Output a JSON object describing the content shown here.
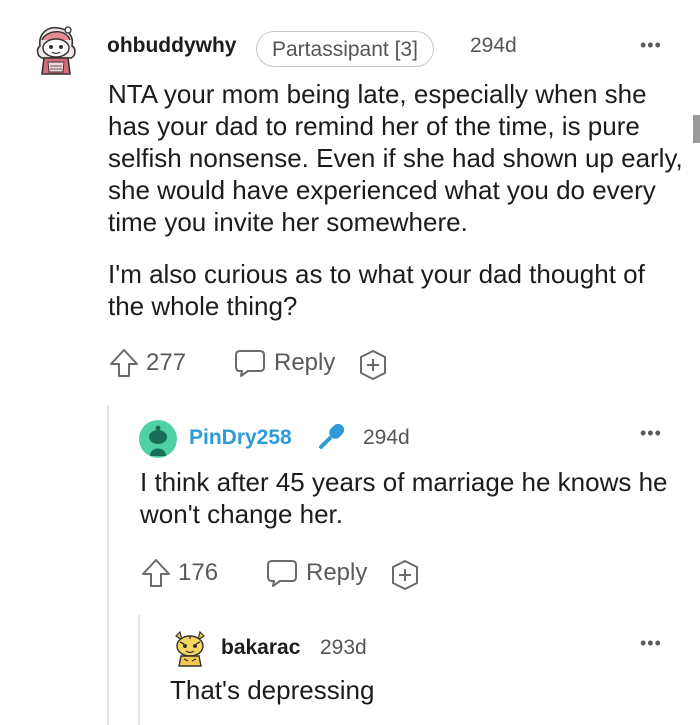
{
  "comment": {
    "username": "ohbuddywhy",
    "flair": "Partassipant [3]",
    "age": "294d",
    "more_icon": "•••",
    "paragraphs": [
      "NTA your mom being late, especially when she has your dad to remind her of the time, is pure selfish nonsense. Even if she had shown up early, she would have experienced what you do every time you invite her somewhere.",
      "I'm also curious as to what your dad thought of the whole thing?"
    ],
    "upvotes": "277",
    "reply_label": "Reply",
    "icons": {
      "avatar": "snoo-avatar-icon",
      "upvote": "upvote-arrow-icon",
      "reply": "speech-bubble-icon",
      "award": "award-plus-icon"
    }
  },
  "reply1": {
    "username": "PinDry258",
    "age": "294d",
    "more_icon": "•••",
    "text": "I think after 45 years of marriage he knows he won't change her.",
    "upvotes": "176",
    "reply_label": "Reply",
    "icons": {
      "avatar": "green-snoo-avatar-icon",
      "badge": "microphone-icon"
    },
    "username_color": "#2e9ad6"
  },
  "reply2": {
    "username": "bakarac",
    "age": "293d",
    "more_icon": "•••",
    "text": "That's depressing",
    "icons": {
      "avatar": "yellow-snoo-avatar-icon"
    }
  },
  "colors": {
    "text": "#1c1c1c",
    "meta": "#555555",
    "thread_line": "#e6e6e6"
  }
}
